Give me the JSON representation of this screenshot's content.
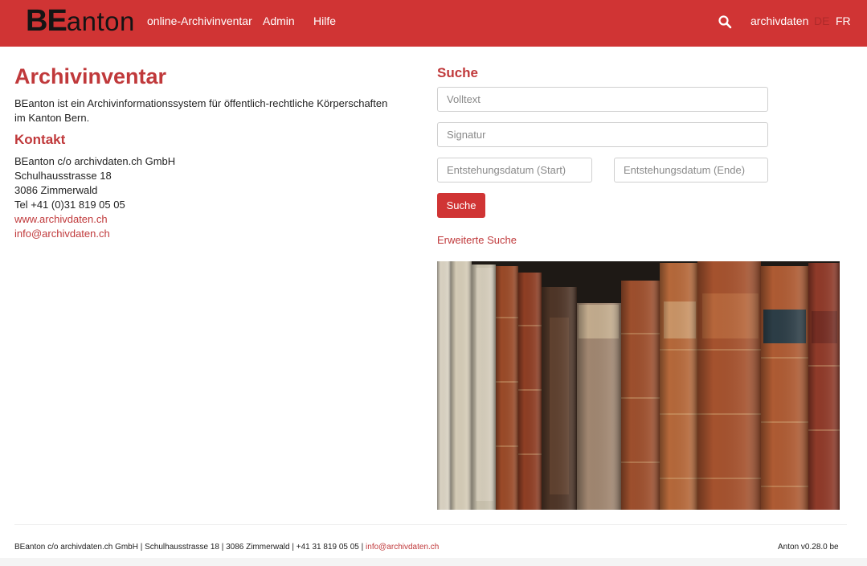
{
  "brand": {
    "logo_bold": "BE",
    "logo_rest": "anton"
  },
  "nav": {
    "items": [
      {
        "label": "online-Archivinventar"
      },
      {
        "label": "Admin"
      },
      {
        "label": "Hilfe"
      }
    ],
    "user": "archivdaten",
    "lang": {
      "de": "DE",
      "fr": "FR",
      "active": "DE"
    },
    "search_icon": "search-icon"
  },
  "main": {
    "title": "Archivinventar",
    "intro": "BEanton ist ein Archivinformationssystem für öffentlich-rechtliche Körperschaften im Kanton Bern.",
    "contact": {
      "title": "Kontakt",
      "lines": [
        "BEanton c/o archivdaten.ch GmbH",
        "Schulhausstrasse 18",
        "3086 Zimmerwald",
        "Tel +41 (0)31 819 05 05"
      ],
      "website": "www.archivdaten.ch",
      "email": "info@archivdaten.ch"
    }
  },
  "search": {
    "title": "Suche",
    "fulltext": {
      "placeholder": "Volltext",
      "value": ""
    },
    "signature": {
      "placeholder": "Signatur",
      "value": ""
    },
    "date_start": {
      "placeholder": "Entstehungsdatum (Start)",
      "value": ""
    },
    "date_end": {
      "placeholder": "Entstehungsdatum (Ende)",
      "value": ""
    },
    "button": "Suche",
    "advanced": "Erweiterte Suche"
  },
  "footer": {
    "address": "BEanton c/o archivdaten.ch GmbH | Schulhausstrasse 18 | 3086 Zimmerwald | +41 31 819 05 05 | ",
    "email": "info@archivdaten.ch",
    "version": "Anton v0.28.0 be"
  },
  "colors": {
    "accent": "#d03434",
    "link": "#c0393b"
  }
}
